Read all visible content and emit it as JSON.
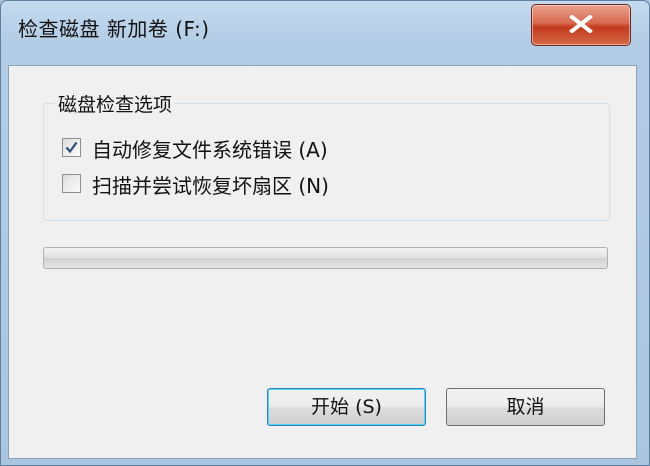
{
  "window": {
    "title": "检查磁盘 新加卷 (F:)",
    "close_icon": "close-x-icon"
  },
  "options": {
    "group_label": "磁盘检查选项",
    "items": [
      {
        "label": "自动修复文件系统错误 (A)",
        "checked": true
      },
      {
        "label": "扫描并尝试恢复坏扇区 (N)",
        "checked": false
      }
    ]
  },
  "progress": {
    "value": 0
  },
  "buttons": {
    "start_label": "开始 (S)",
    "cancel_label": "取消"
  }
}
